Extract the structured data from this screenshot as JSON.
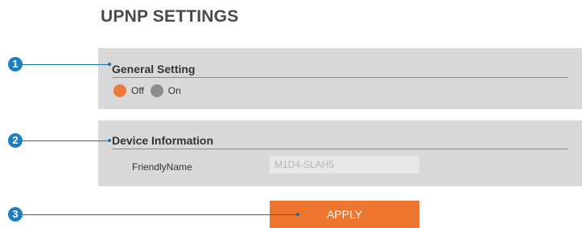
{
  "page": {
    "title": "UPNP SETTINGS"
  },
  "general_setting": {
    "heading": "General Setting",
    "options": [
      {
        "label": "Off",
        "selected": true
      },
      {
        "label": "On",
        "selected": false
      }
    ]
  },
  "device_information": {
    "heading": "Device Information",
    "friendly_name_label": "FriendlyName",
    "friendly_name_value": "M1D4-SLAH5"
  },
  "actions": {
    "apply_label": "APPLY"
  },
  "callouts": [
    "1",
    "2",
    "3"
  ],
  "colors": {
    "accent": "#ec7530",
    "radio_selected": "#ec7a3a",
    "radio_unselected": "#8c8c8c",
    "panel_bg": "#d9d9d9",
    "callout_blue": "#1f7fc4"
  }
}
